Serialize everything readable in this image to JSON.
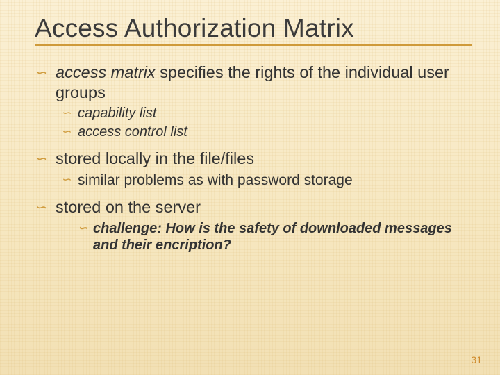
{
  "slide": {
    "title": "Access Authorization Matrix",
    "page_number": "31",
    "bullets": {
      "b1": {
        "italic_part": "access matrix",
        "rest": " specifies the rights of the individual user groups",
        "sub": {
          "s1": "capability list",
          "s2": "access control list"
        }
      },
      "b2": {
        "text": "stored locally in the file/files",
        "sub": {
          "s1": "similar problems as with password storage"
        }
      },
      "b3": {
        "text": "stored on the server",
        "sub": {
          "s1": "challenge: How is the safety of downloaded messages and their encription?"
        }
      }
    }
  }
}
